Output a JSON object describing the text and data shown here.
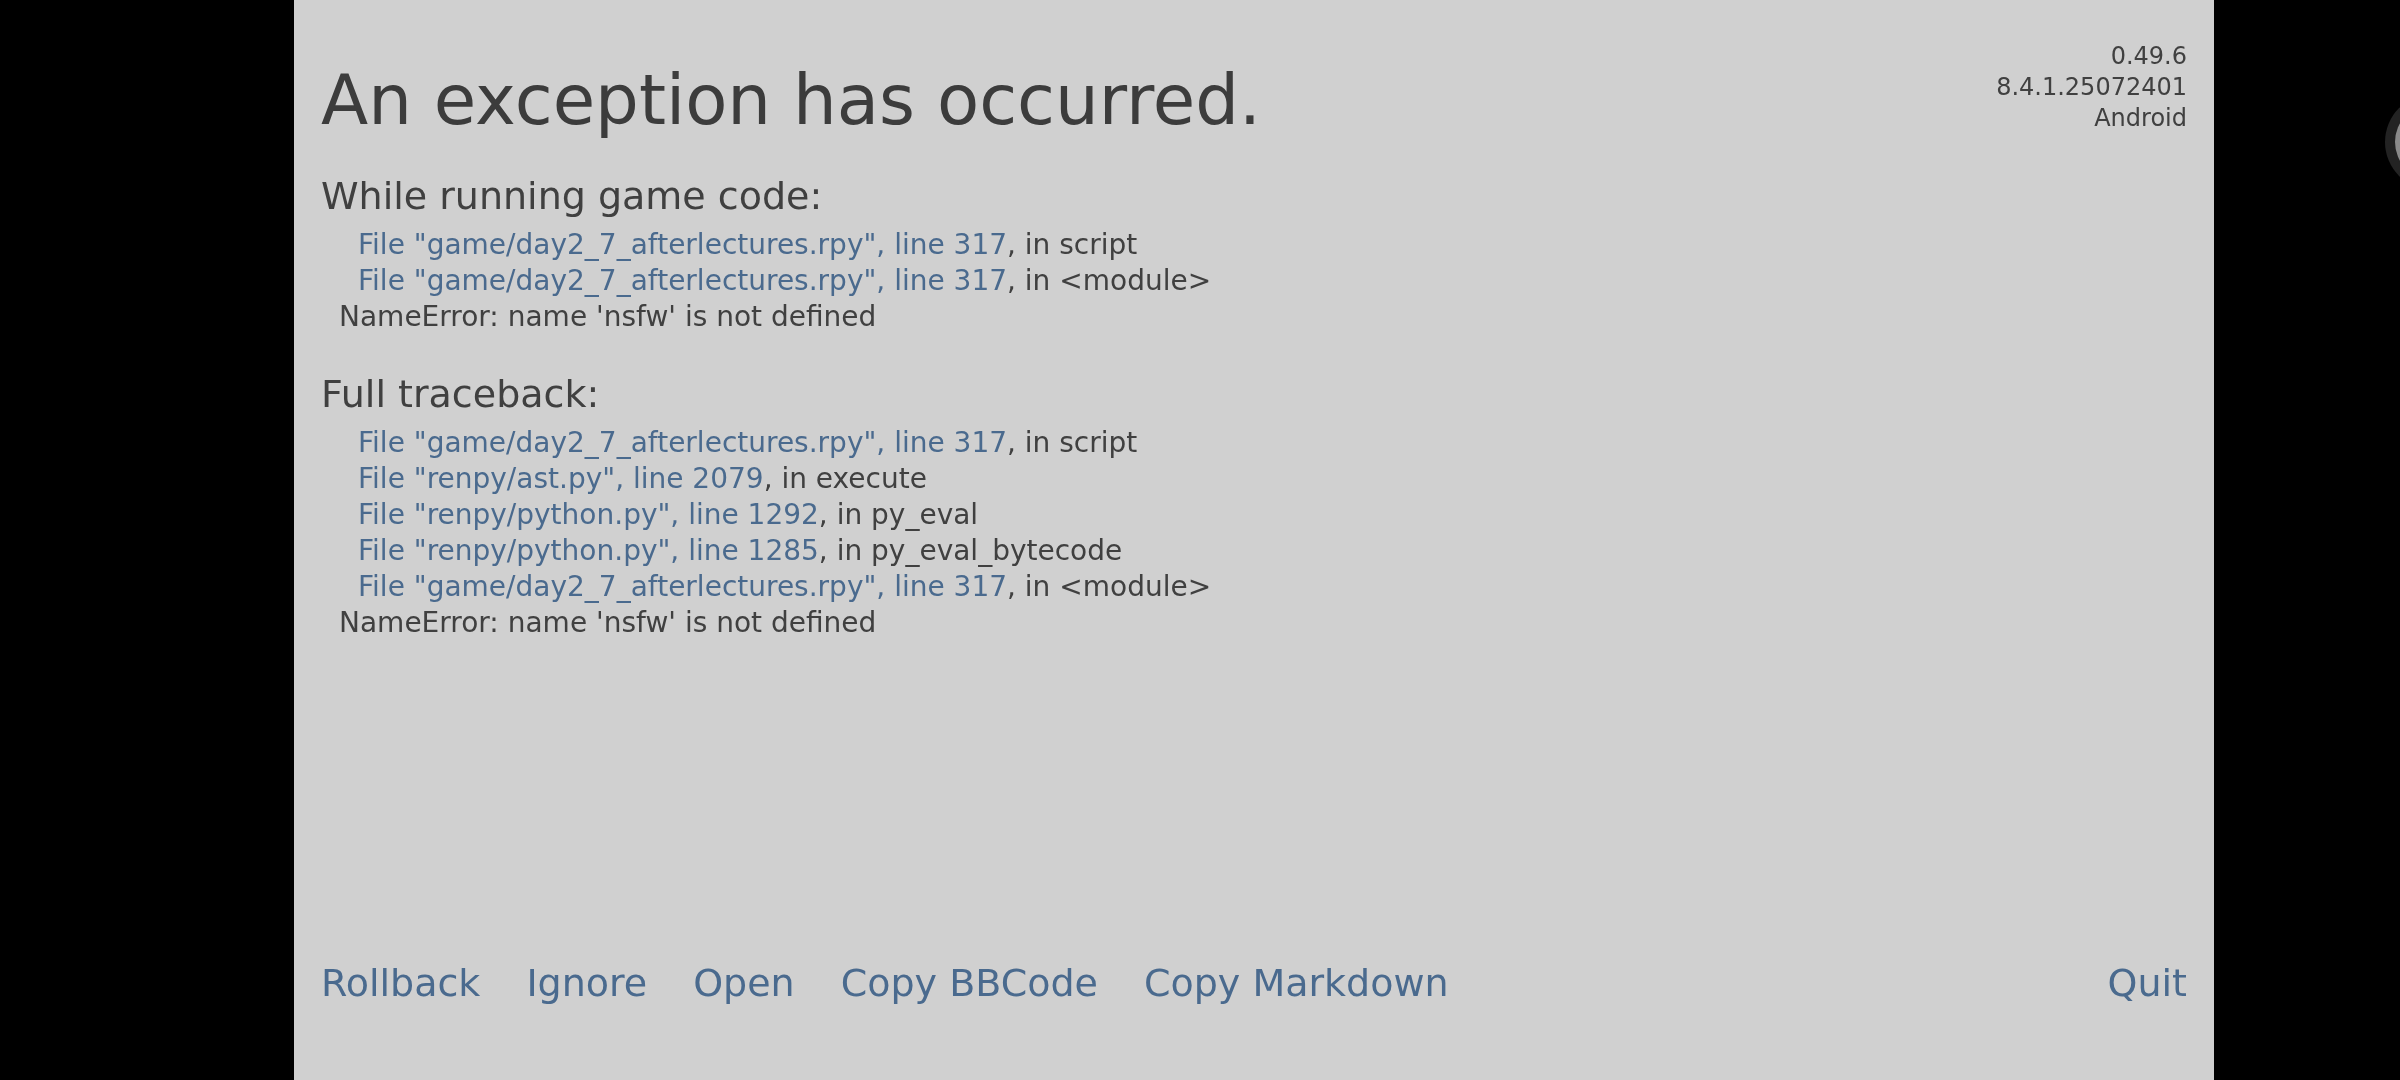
{
  "title": "An exception has occurred.",
  "version_info": [
    "0.49.6",
    "8.4.1.25072401",
    "Android"
  ],
  "sections": [
    {
      "heading": "While running game code:",
      "frames": [
        {
          "location": "File \"game/day2_7_afterlectures.rpy\", line 317",
          "context": ", in script"
        },
        {
          "location": "File \"game/day2_7_afterlectures.rpy\", line 317",
          "context": ", in <module>"
        }
      ],
      "error": "NameError: name 'nsfw' is not defined"
    },
    {
      "heading": "Full traceback:",
      "frames": [
        {
          "location": "File \"game/day2_7_afterlectures.rpy\", line 317",
          "context": ", in script"
        },
        {
          "location": "File \"renpy/ast.py\", line 2079",
          "context": ", in execute"
        },
        {
          "location": "File \"renpy/python.py\", line 1292",
          "context": ", in py_eval"
        },
        {
          "location": "File \"renpy/python.py\", line 1285",
          "context": ", in py_eval_bytecode"
        },
        {
          "location": "File \"game/day2_7_afterlectures.rpy\", line 317",
          "context": ", in <module>"
        }
      ],
      "error": "NameError: name 'nsfw' is not defined"
    }
  ],
  "buttons_left": [
    "Rollback",
    "Ignore",
    "Open",
    "Copy BBCode",
    "Copy Markdown"
  ],
  "buttons_right": [
    "Quit"
  ]
}
